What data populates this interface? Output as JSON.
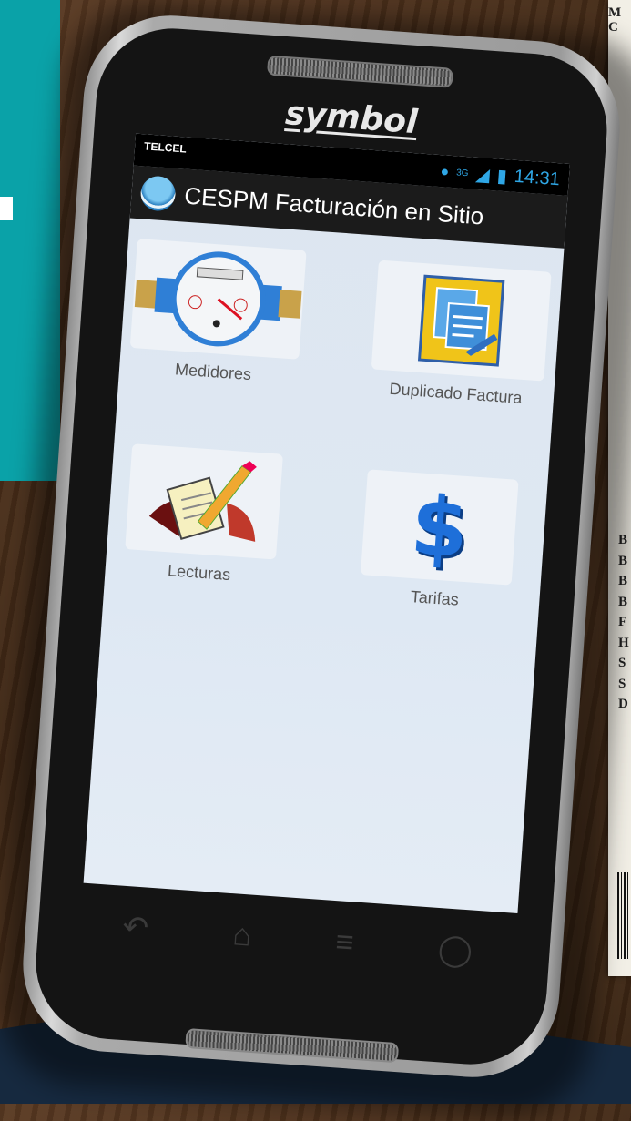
{
  "device": {
    "brand": "symbol"
  },
  "status_bar": {
    "carrier": "TELCEL",
    "network_type": "3G",
    "time": "14:31"
  },
  "action_bar": {
    "title": "CESPM Facturación en Sitio"
  },
  "menu": [
    {
      "label": "Medidores",
      "icon": "water-meter-icon"
    },
    {
      "label": "Duplicado Factura",
      "icon": "duplicate-invoice-icon"
    },
    {
      "label": "Lecturas",
      "icon": "readings-pencil-icon"
    },
    {
      "label": "Tarifas",
      "icon": "dollar-sign-icon"
    }
  ],
  "background_paper": {
    "top_letters": [
      "M",
      "C"
    ],
    "list_letters": [
      "B",
      "B",
      "B",
      "B",
      "F",
      "H",
      "S",
      "S",
      "D"
    ]
  },
  "colors": {
    "accent": "#0aa2a8",
    "action_bar": "#1b1b1b",
    "screen_bg": "#dee8f3",
    "status_icon": "#2fa7e6",
    "navy_band": "#16293f"
  }
}
